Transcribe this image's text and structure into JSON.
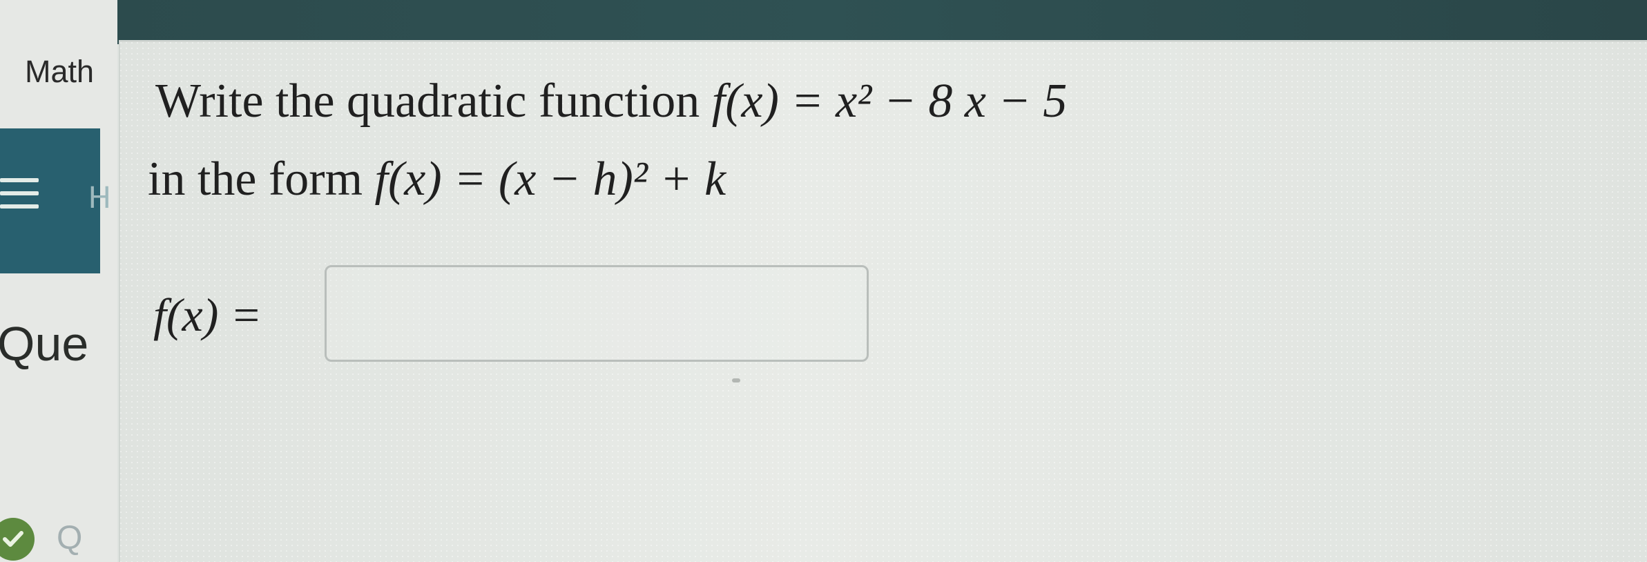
{
  "sidebar": {
    "app_label": "Math",
    "menu_letter": "H",
    "section_heading": "Que",
    "bottom_letter": "Q"
  },
  "question": {
    "prompt_prefix": "Write the quadratic function",
    "prompt_function": "f(x) = x² − 8 x − 5",
    "instruction_prefix": "in the form",
    "instruction_form": "f(x) = (x − h)² + k",
    "answer_label": "f(x) =",
    "answer_value": ""
  },
  "icons": {
    "menu": "hamburger-icon",
    "status": "check-icon"
  },
  "colors": {
    "top_bar": "#2f5153",
    "menu_panel": "#28606f",
    "status_check": "#5d8a3f",
    "text": "#202020"
  }
}
